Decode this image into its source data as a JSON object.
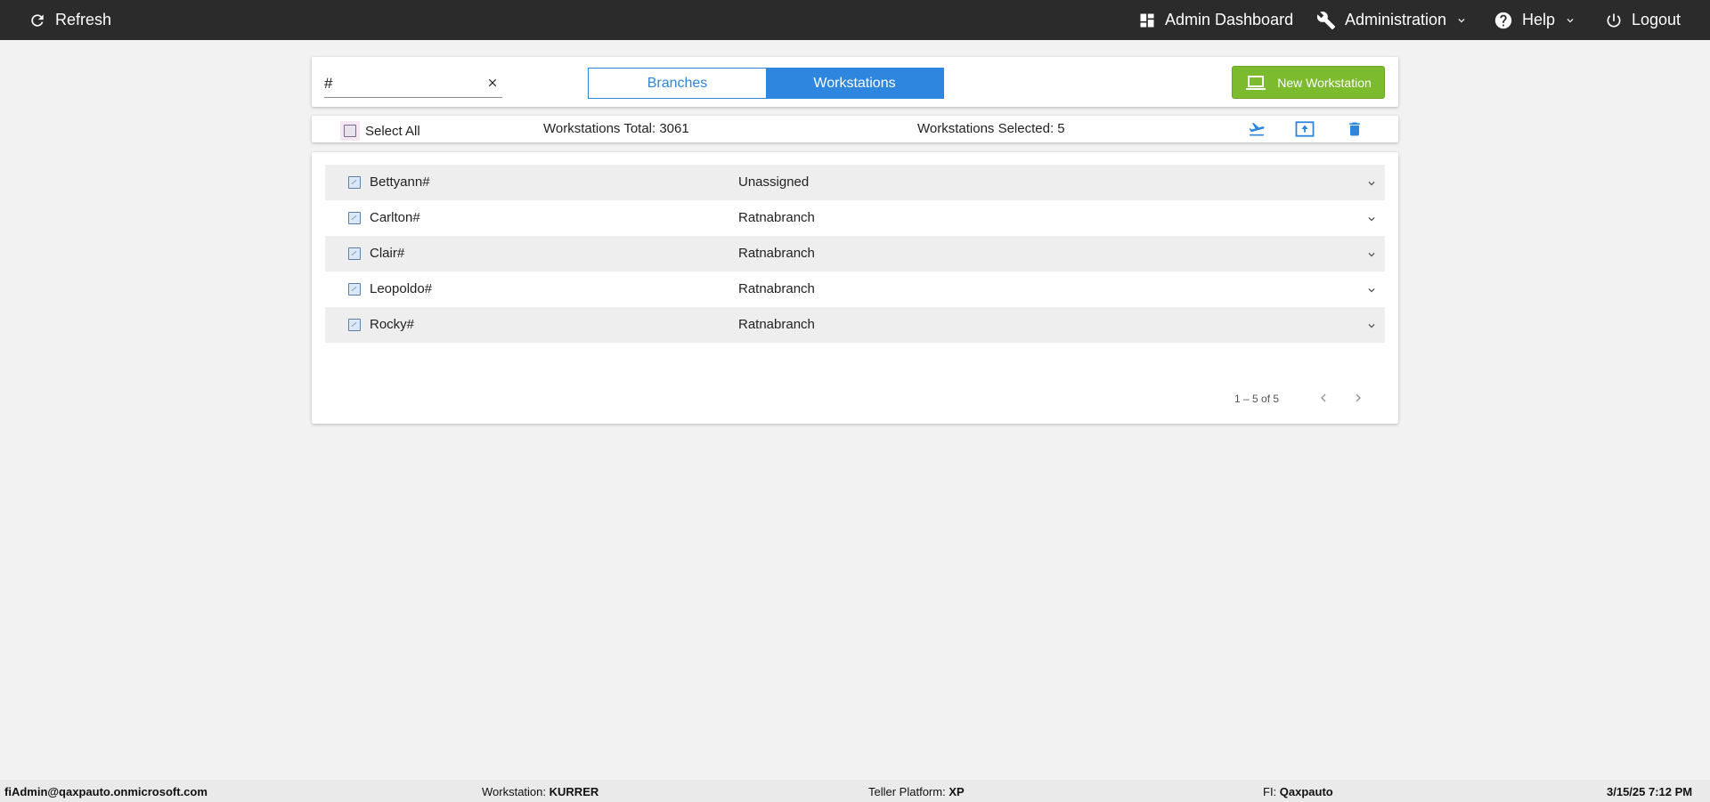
{
  "topbar": {
    "refresh": "Refresh",
    "admin_dashboard": "Admin Dashboard",
    "administration": "Administration",
    "help": "Help",
    "logout": "Logout"
  },
  "search": {
    "value": "#"
  },
  "view_toggle": {
    "branches": "Branches",
    "workstations": "Workstations",
    "active": "Workstations"
  },
  "new_button": {
    "label": "New Workstation"
  },
  "selection": {
    "select_all": "Select All",
    "total": "Workstations Total: 3061",
    "selected": "Workstations Selected: 5"
  },
  "rows": [
    {
      "name": "Bettyann#",
      "branch": "Unassigned",
      "checked": true
    },
    {
      "name": "Carlton#",
      "branch": "Ratnabranch",
      "checked": true
    },
    {
      "name": "Clair#",
      "branch": "Ratnabranch",
      "checked": true
    },
    {
      "name": "Leopoldo#",
      "branch": "Ratnabranch",
      "checked": true
    },
    {
      "name": "Rocky#",
      "branch": "Ratnabranch",
      "checked": true
    }
  ],
  "pagination": {
    "range": "1 – 5 of 5"
  },
  "footer": {
    "user": "fiAdmin@qaxpauto.onmicrosoft.com",
    "workstation_label": "Workstation:",
    "workstation_value": "KURRER",
    "teller_label": "Teller Platform:",
    "teller_value": "XP",
    "fi_label": "FI:",
    "fi_value": "Qaxpauto",
    "datetime": "3/15/25 7:12 PM"
  },
  "colors": {
    "accent": "#2e86de",
    "new_button": "#7cba2e",
    "topbar": "#2b2b2b"
  }
}
